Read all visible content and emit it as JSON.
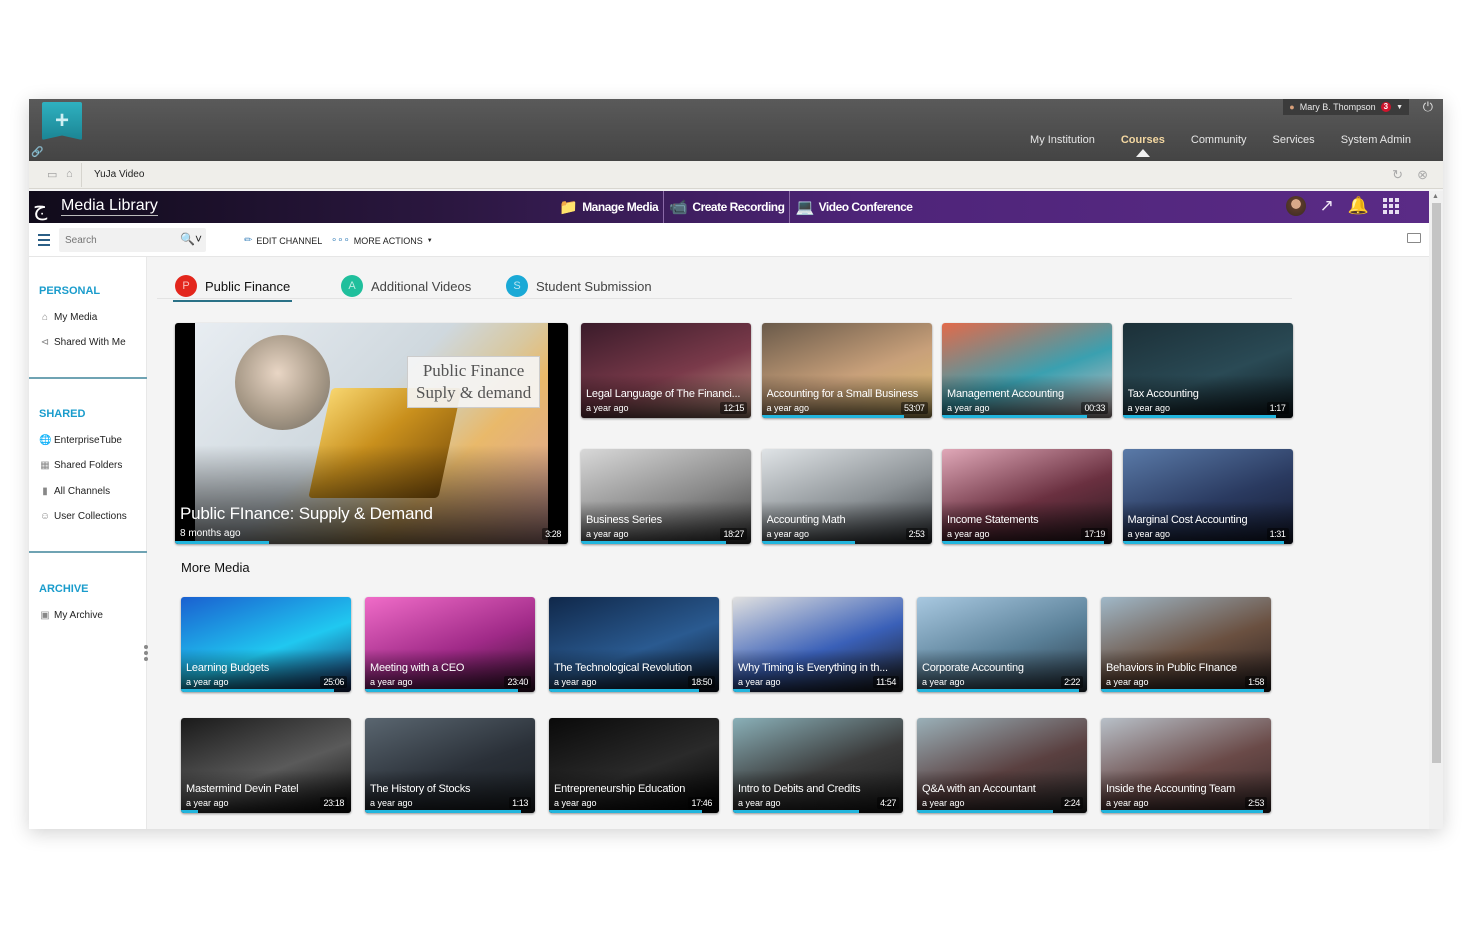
{
  "lms": {
    "user_name": "Mary B. Thompson",
    "notification_count": "3",
    "nav": [
      {
        "label": "My Institution",
        "active": false
      },
      {
        "label": "Courses",
        "active": true
      },
      {
        "label": "Community",
        "active": false
      },
      {
        "label": "Services",
        "active": false
      },
      {
        "label": "System Admin",
        "active": false
      }
    ],
    "breadcrumb": "YuJa Video"
  },
  "header": {
    "title": "Media Library",
    "actions": [
      {
        "label": "Manage Media",
        "icon": "folder-play-icon"
      },
      {
        "label": "Create Recording",
        "icon": "record-icon"
      },
      {
        "label": "Video Conference",
        "icon": "video-conference-icon"
      }
    ]
  },
  "toolbar": {
    "search_placeholder": "Search",
    "edit_channel": "EDIT CHANNEL",
    "more_actions": "MORE ACTIONS"
  },
  "sidebar": {
    "personal_heading": "PERSONAL",
    "personal": [
      {
        "label": "My Media",
        "icon": "home-icon"
      },
      {
        "label": "Shared With Me",
        "icon": "share-icon"
      }
    ],
    "shared_heading": "SHARED",
    "shared": [
      {
        "label": "EnterpriseTube",
        "icon": "globe-icon"
      },
      {
        "label": "Shared Folders",
        "icon": "building-icon"
      },
      {
        "label": "All Channels",
        "icon": "library-icon"
      },
      {
        "label": "User Collections",
        "icon": "user-icon"
      }
    ],
    "archive_heading": "ARCHIVE",
    "archive": [
      {
        "label": "My Archive",
        "icon": "archive-icon"
      }
    ]
  },
  "tabs": [
    {
      "letter": "P",
      "label": "Public Finance",
      "color": "#e3261c",
      "active": true
    },
    {
      "letter": "A",
      "label": "Additional Videos",
      "color": "#1fbf9c",
      "active": false
    },
    {
      "letter": "S",
      "label": "Student Submission",
      "color": "#1aa9d6",
      "active": false
    }
  ],
  "featured": {
    "title": "Public FInance: Supply & Demand",
    "overlay_line1": "Public Finance",
    "overlay_line2": "Suply & demand",
    "age": "8 months ago",
    "duration": "3:28",
    "progress": 0.24
  },
  "channel_videos": [
    {
      "title": "Legal Language of The Financi...",
      "age": "a year ago",
      "duration": "12:15",
      "progress": 0,
      "colors": [
        "#3a1b2a",
        "#7a3a4a",
        "#c9a08a"
      ]
    },
    {
      "title": "Accounting for a Small Business",
      "age": "a year ago",
      "duration": "53:07",
      "progress": 0.84,
      "colors": [
        "#6a5a4a",
        "#c8a07a",
        "#e0c070"
      ]
    },
    {
      "title": "Management Accounting",
      "age": "a year ago",
      "duration": "00:33",
      "progress": 0.85,
      "colors": [
        "#e26a4a",
        "#3aa0b0",
        "#d8c0c0"
      ]
    },
    {
      "title": "Tax Accounting",
      "age": "a year ago",
      "duration": "1:17",
      "progress": 0.9,
      "colors": [
        "#1c3038",
        "#2a4a55",
        "#0e1a20"
      ]
    },
    {
      "title": "Business Series",
      "age": "a year ago",
      "duration": "18:27",
      "progress": 0.85,
      "colors": [
        "#d8d8d8",
        "#8a8a8a",
        "#3a3a3a"
      ]
    },
    {
      "title": "Accounting Math",
      "age": "a year ago",
      "duration": "2:53",
      "progress": 0.55,
      "colors": [
        "#dfe3e6",
        "#8c9296",
        "#2e3236"
      ]
    },
    {
      "title": "Income Statements",
      "age": "a year ago",
      "duration": "17:19",
      "progress": 0.95,
      "colors": [
        "#e0a8b8",
        "#6a3040",
        "#2a1a20"
      ]
    },
    {
      "title": "Marginal Cost Accounting",
      "age": "a year ago",
      "duration": "1:31",
      "progress": 0.95,
      "colors": [
        "#5a7aa8",
        "#2a3a60",
        "#141a30"
      ]
    }
  ],
  "more_media": {
    "title": "More Media",
    "videos": [
      {
        "title": "Learning Budgets",
        "age": "a year ago",
        "duration": "25:06",
        "progress": 0.9,
        "colors": [
          "#1a60d0",
          "#20c8f0",
          "#1a2a60"
        ]
      },
      {
        "title": "Meeting with a CEO",
        "age": "a year ago",
        "duration": "23:40",
        "progress": 0.9,
        "colors": [
          "#f06cc8",
          "#a02a88",
          "#3a1030"
        ]
      },
      {
        "title": "The Technological Revolution",
        "age": "a year ago",
        "duration": "18:50",
        "progress": 0.88,
        "colors": [
          "#10284a",
          "#2a5a90",
          "#0a1424"
        ]
      },
      {
        "title": "Why Timing is Everything in th...",
        "age": "a year ago",
        "duration": "11:54",
        "progress": 0.1,
        "colors": [
          "#e0e0e0",
          "#3a60b8",
          "#1a1a1a"
        ]
      },
      {
        "title": "Corporate Accounting",
        "age": "a year ago",
        "duration": "2:22",
        "progress": 0.95,
        "colors": [
          "#a8c8e0",
          "#5a8098",
          "#2a3a48"
        ]
      },
      {
        "title": "Behaviors in Public FInance",
        "age": "a year ago",
        "duration": "1:58",
        "progress": 0.96,
        "colors": [
          "#a0b8c8",
          "#6a5040",
          "#2a2020"
        ]
      },
      {
        "title": "Mastermind Devin Patel",
        "age": "a year ago",
        "duration": "23:18",
        "progress": 0.1,
        "colors": [
          "#1a1a1a",
          "#5a5a5a",
          "#0a0a0a"
        ]
      },
      {
        "title": "The History of Stocks",
        "age": "a year ago",
        "duration": "1:13",
        "progress": 0.92,
        "colors": [
          "#5a6670",
          "#2a3038",
          "#1a1e22"
        ]
      },
      {
        "title": "Entrepreneurship Education",
        "age": "a year ago",
        "duration": "17:46",
        "progress": 0.9,
        "colors": [
          "#0a0a0a",
          "#2a2a2a",
          "#000000"
        ]
      },
      {
        "title": "Intro to Debits and Credits",
        "age": "a year ago",
        "duration": "4:27",
        "progress": 0.74,
        "colors": [
          "#8ab0b8",
          "#3a3a3a",
          "#1a1a1a"
        ]
      },
      {
        "title": "Q&A with an Accountant",
        "age": "a year ago",
        "duration": "2:24",
        "progress": 0.8,
        "colors": [
          "#9ab0b8",
          "#5a4040",
          "#2a2a2a"
        ]
      },
      {
        "title": "Inside the Accounting Team",
        "age": "a year ago",
        "duration": "2:53",
        "progress": 0.95,
        "colors": [
          "#b8c0c8",
          "#6a4a48",
          "#3a2a2a"
        ]
      }
    ]
  }
}
